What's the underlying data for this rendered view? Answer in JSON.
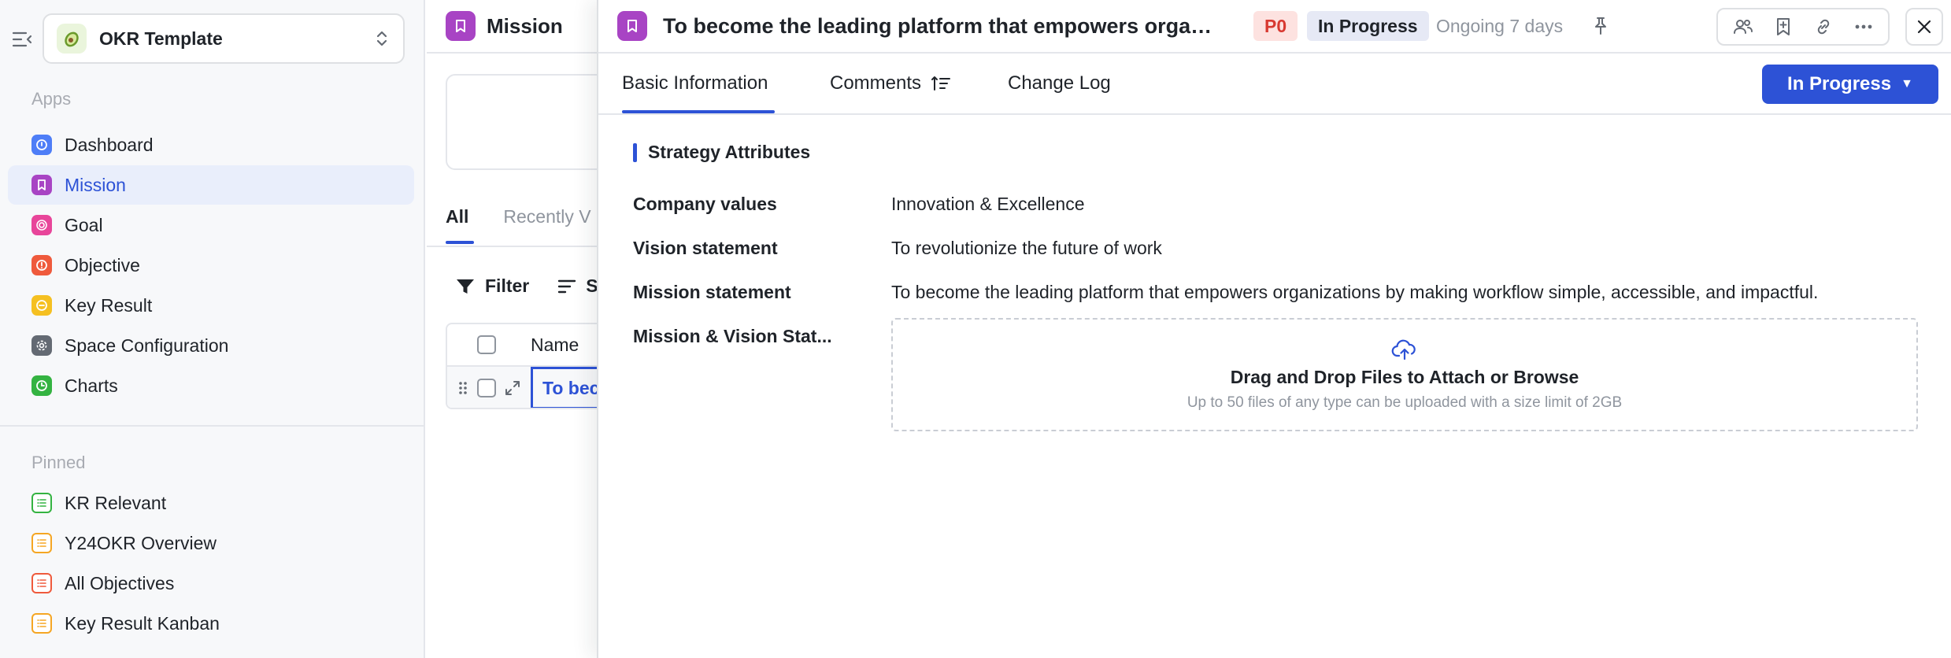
{
  "sidebar": {
    "workspace_name": "OKR Template",
    "apps_title": "Apps",
    "apps": [
      {
        "label": "Dashboard",
        "color": "#4e7ef7",
        "icon": "dashboard-icon"
      },
      {
        "label": "Mission",
        "color": "#a844c4",
        "icon": "bookmark-icon"
      },
      {
        "label": "Goal",
        "color": "#e8459a",
        "icon": "target-icon"
      },
      {
        "label": "Objective",
        "color": "#ef5a3c",
        "icon": "alert-circle-icon"
      },
      {
        "label": "Key Result",
        "color": "#f5c021",
        "icon": "key-result-icon"
      },
      {
        "label": "Space Configuration",
        "color": "#646a73",
        "icon": "gear-icon"
      },
      {
        "label": "Charts",
        "color": "#34b341",
        "icon": "clock-icon"
      }
    ],
    "pinned_title": "Pinned",
    "pinned": [
      {
        "label": "KR Relevant",
        "color": "#34b341"
      },
      {
        "label": "Y24OKR Overview",
        "color": "#f5a623"
      },
      {
        "label": "All Objectives",
        "color": "#ef5a3c"
      },
      {
        "label": "Key Result Kanban",
        "color": "#f5a623"
      }
    ]
  },
  "middle": {
    "title": "Mission",
    "tabs": [
      "All",
      "Recently V"
    ],
    "filter_label": "Filter",
    "sort_label": "S",
    "column_name": "Name",
    "row_text": "To bec"
  },
  "drawer": {
    "title": "To become the leading platform that empowers organiz...",
    "priority": "P0",
    "status_badge": "In Progress",
    "ongoing": "Ongoing 7 days",
    "tabs": {
      "basic": "Basic Information",
      "comments": "Comments",
      "changelog": "Change Log"
    },
    "status_button": "In Progress",
    "section_title": "Strategy Attributes",
    "fields": [
      {
        "label": "Company values",
        "value": "Innovation & Excellence"
      },
      {
        "label": "Vision statement",
        "value": "To revolutionize the future of work"
      },
      {
        "label": "Mission statement",
        "value": "To become the leading platform that empowers organizations by making workflow simple, accessible, and impactful."
      },
      {
        "label": "Mission & Vision Stat...",
        "value": ""
      }
    ],
    "upload": {
      "title": "Drag and Drop Files to Attach or Browse",
      "subtitle": "Up to 50 files of any type can be uploaded with a size limit of 2GB"
    }
  },
  "colors": {
    "accent": "#2d52d6",
    "mission_purple": "#a844c4",
    "p0_red": "#d83931"
  }
}
